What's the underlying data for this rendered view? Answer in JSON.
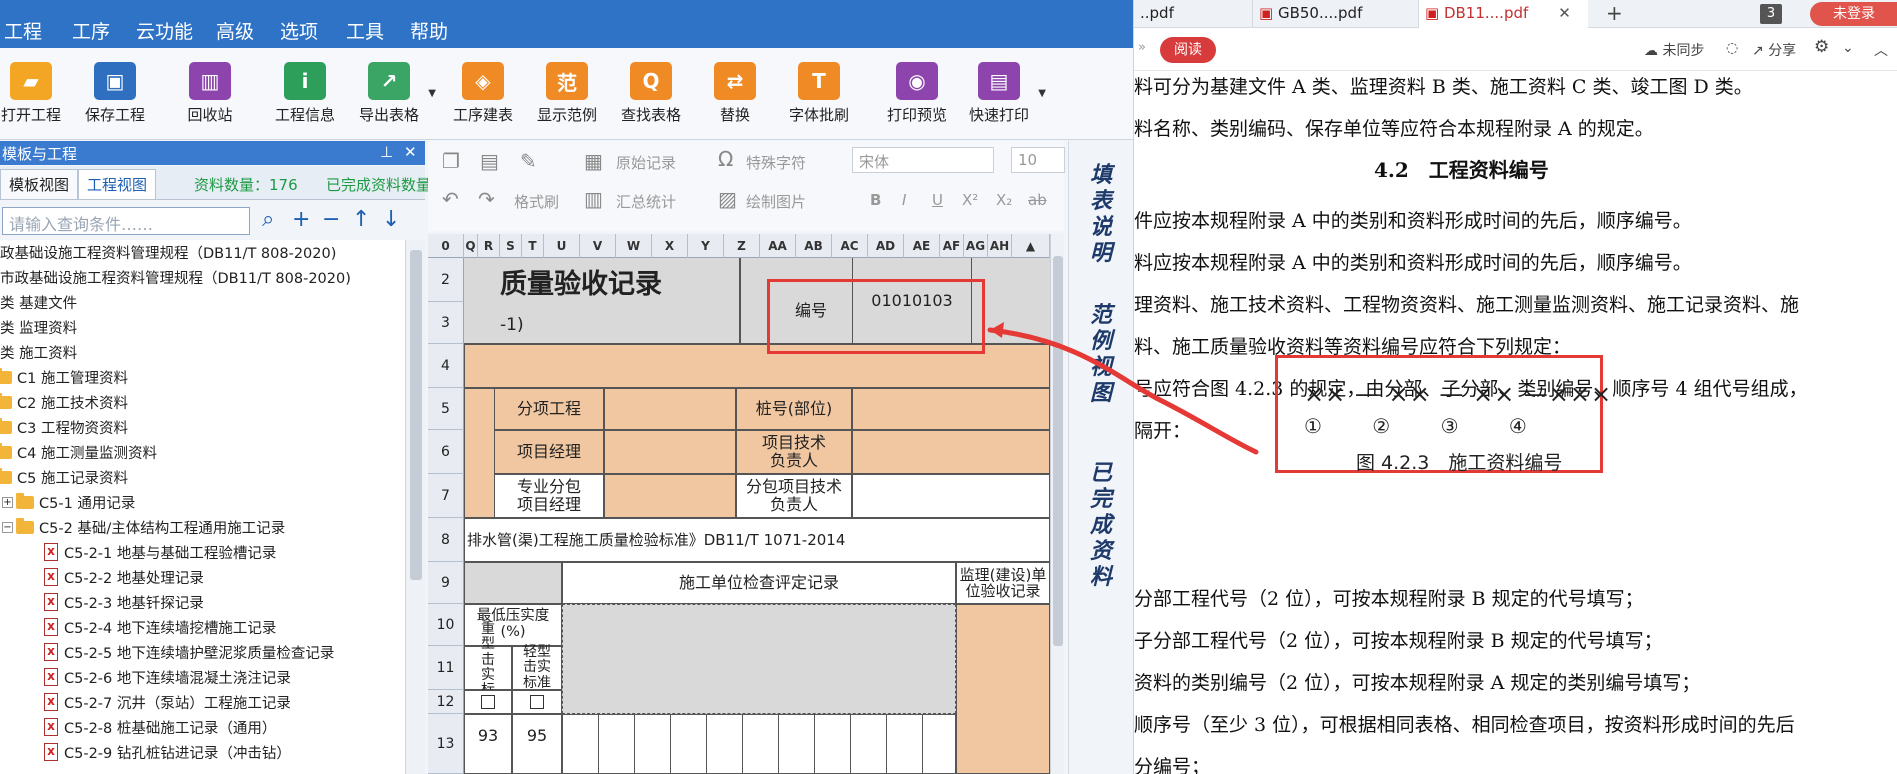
{
  "menubar": {
    "items": [
      "工程",
      "工序",
      "云功能",
      "高级",
      "选项",
      "工具",
      "帮助"
    ]
  },
  "toolbar": {
    "items": [
      "打开工程",
      "保存工程",
      "回收站",
      "工程信息",
      "导出表格",
      "工序建表",
      "显示范例",
      "查找表格",
      "替换",
      "字体批刷",
      "打印预览",
      "快速打印"
    ]
  },
  "panel": {
    "title": "模板与工程",
    "tabs": [
      "模板视图",
      "工程视图"
    ],
    "count": "资料数量：176",
    "done": "已完成资料数量",
    "search_placeholder": "请输入查询条件……"
  },
  "tree": [
    "政基础设施工程资料管理规程（DB11/T 808-2020)",
    "市政基础设施工程资料管理规程（DB11/T 808-2020)",
    "类 基建文件",
    "类 监理资料",
    "类 施工资料",
    "C1 施工管理资料",
    "C2 施工技术资料",
    "C3 工程物资资料",
    "C4 施工测量监测资料",
    "C5 施工记录资料",
    "C5-1 通用记录",
    "C5-2 基础/主体结构工程通用施工记录",
    "C5-2-1 地基与基础工程验槽记录",
    "C5-2-2 地基处理记录",
    "C5-2-3 地基钎探记录",
    "C5-2-4 地下连续墙挖槽施工记录",
    "C5-2-5 地下连续墙护壁泥浆质量检查记录",
    "C5-2-6 地下连续墙混凝土浇注记录",
    "C5-2-7 沉井（泵站）工程施工记录",
    "C5-2-8 桩基础施工记录（通用）",
    "C5-2-9 钻孔桩钻进记录（冲击钻）"
  ],
  "editor": {
    "tools": [
      "原始记录",
      "特殊字符",
      "格式刷",
      "汇总统计",
      "绘制图片"
    ],
    "font": "宋体",
    "size": "10",
    "format_buttons": [
      "B",
      "I",
      "U",
      "X²",
      "X₂",
      "ab"
    ]
  },
  "sheet": {
    "columns": [
      "0",
      "Q",
      "R",
      "S",
      "T",
      "U",
      "V",
      "W",
      "X",
      "Y",
      "Z",
      "AA",
      "AB",
      "AC",
      "AD",
      "AE",
      "AF",
      "AG",
      "AH"
    ],
    "rows": [
      "2",
      "3",
      "4",
      "5",
      "6",
      "7",
      "8",
      "9",
      "10",
      "11",
      "12",
      "13"
    ],
    "title": "质量验收记录",
    "subtitle": "-1)",
    "number_label": "编号",
    "number_value": "01010103",
    "sub_item": "分项工程",
    "pile_no": "桩号(部位)",
    "pm": "项目经理",
    "tech_lead": "项目技术负责人",
    "sub_pm": "专业分包项目经理",
    "sub_tech": "分包项目技术负责人",
    "standard": "排水管(渠)工程施工质量检验标准》DB11/T 1071-2014",
    "inspect": "施工单位检查评定记录",
    "supervision": "监理(建设)单位验收记录",
    "compaction": "最低压实度(%)",
    "heavy": "重型击实标准",
    "light": "轻型击实标准",
    "v93": "93",
    "v95": "95"
  },
  "sidetabs": [
    "填表说明",
    "范例视图",
    "已完成资料"
  ],
  "pdf": {
    "tabs": [
      "..pdf",
      "GB50....pdf",
      "DB11....pdf"
    ],
    "tab_count": "3",
    "login": "未登录",
    "read_btn": "阅读",
    "sync": "未同步",
    "share": "分享",
    "lines": [
      "料可分为基建文件 A 类、监理资料 B 类、施工资料 C 类、竣工图 D 类。",
      "料名称、类别编码、保存单位等应符合本规程附录 A 的规定。",
      "4.2　工程资料编号",
      "件应按本规程附录 A 中的类别和资料形成时间的先后，顺序编号。",
      "料应按本规程附录 A 中的类别和资料形成时间的先后，顺序编号。",
      "理资料、施工技术资料、工程物资资料、施工测量监测资料、施工记录资料、施",
      "料、施工质量验收资料等资料编号应符合下列规定：",
      "号应符合图 4.2.3 的规定，由分部、子分部、类别编号、顺序号 4 组代号组成，",
      "隔开：",
      "分部工程代号（2 位），可按本规程附录 B 规定的代号填写；",
      "子分部工程代号（2 位），可按本规程附录 B 规定的代号填写；",
      "资料的类别编号（2 位），可按本规程附录 A 规定的类别编号填写；",
      "顺序号（至少 3 位），可根据相同表格、相同检查项目，按资料形成时间的先后",
      "分编号；"
    ],
    "figure": {
      "code": "×× — ×× — ×× —×××",
      "marks": "① ② ③ ④",
      "caption": "图 4.2.3　施工资料编号"
    }
  },
  "colors": {
    "accent": "#2f73c6",
    "highlight": "#e53935",
    "peach": "#f1c7a2"
  }
}
